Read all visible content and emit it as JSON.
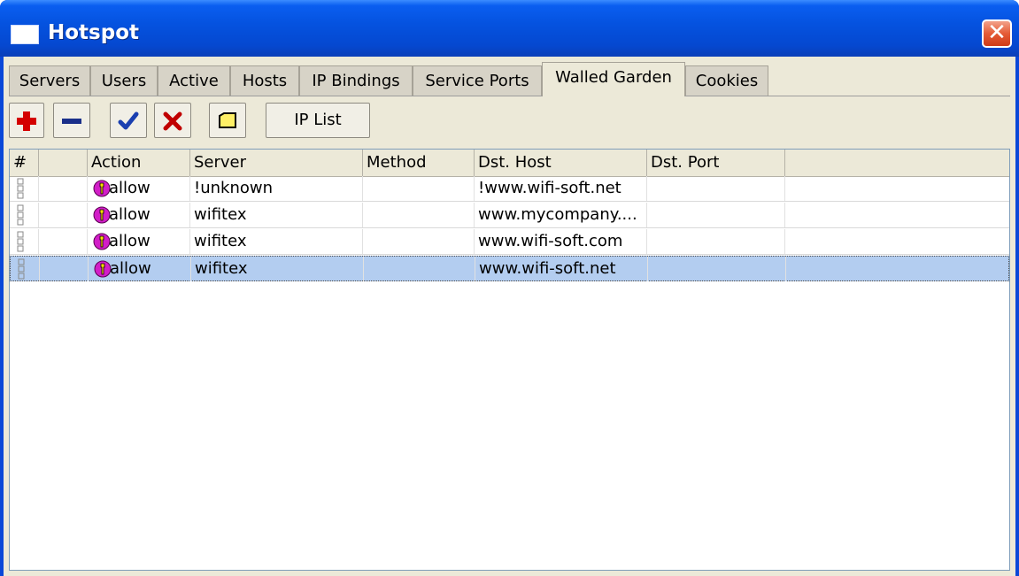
{
  "window": {
    "title": "Hotspot",
    "close_symbol": "✕"
  },
  "tabs": [
    {
      "label": "Servers"
    },
    {
      "label": "Users"
    },
    {
      "label": "Active"
    },
    {
      "label": "Hosts"
    },
    {
      "label": "IP Bindings"
    },
    {
      "label": "Service Ports"
    },
    {
      "label": "Walled Garden",
      "active": true
    },
    {
      "label": "Cookies"
    }
  ],
  "toolbar": {
    "add_icon": "plus-icon",
    "remove_icon": "minus-icon",
    "enable_icon": "check-icon",
    "disable_icon": "x-icon",
    "comment_icon": "note-icon",
    "ip_list_label": "IP List"
  },
  "table": {
    "columns": [
      "#",
      "",
      "Action",
      "Server",
      "Method",
      "Dst. Host",
      "Dst. Port"
    ],
    "rows": [
      {
        "action": "allow",
        "server": "!unknown",
        "method": "",
        "dst_host": "!www.wifi-soft.net",
        "dst_port": ""
      },
      {
        "action": "allow",
        "server": "wifitex",
        "method": "",
        "dst_host": "www.mycompany....",
        "dst_port": ""
      },
      {
        "action": "allow",
        "server": "wifitex",
        "method": "",
        "dst_host": "www.wifi-soft.com",
        "dst_port": ""
      },
      {
        "action": "allow",
        "server": "wifitex",
        "method": "",
        "dst_host": "www.wifi-soft.net",
        "dst_port": "",
        "selected": true
      }
    ]
  },
  "colors": {
    "titlebar": "#0553e0",
    "client_bg": "#ece9d8",
    "selection": "#b3cdf0",
    "add_red": "#d40000",
    "remove_blue": "#1a2f8a",
    "check_blue": "#1a3fb0",
    "x_red": "#c00000",
    "note_yellow": "#fff066",
    "allow_icon_magenta": "#d21ec8"
  }
}
